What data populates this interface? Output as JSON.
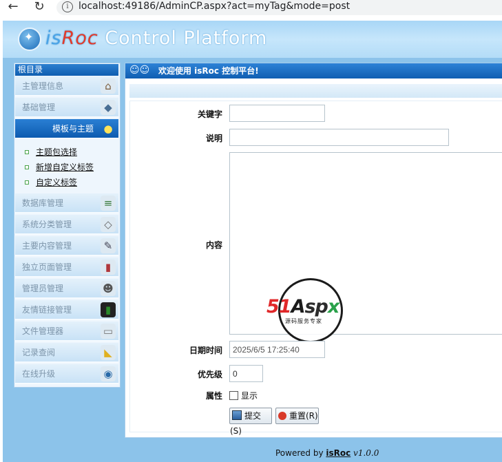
{
  "browser": {
    "url": "localhost:49186/AdminCP.aspx?act=myTag&mode=post",
    "back_glyph": "←",
    "reload_glyph": "↻",
    "info_glyph": "i"
  },
  "banner": {
    "logo_is": "is",
    "logo_roc": "Roc",
    "logo_rest": " Control Platform",
    "logo_glyph": "✦"
  },
  "sidebar": {
    "header": "根目录",
    "items": [
      {
        "label": "主管理信息",
        "icon": "house-icon",
        "glyph": "⌂"
      },
      {
        "label": "基础管理",
        "icon": "cube-icon",
        "glyph": "◆"
      },
      {
        "label": "模板与主题",
        "icon": "lightbulb-icon",
        "glyph": "●",
        "active": true
      },
      {
        "label": "数据库管理",
        "icon": "database-icon",
        "glyph": "≡"
      },
      {
        "label": "系统分类管理",
        "icon": "tag-icon",
        "glyph": "◇"
      },
      {
        "label": "主要内容管理",
        "icon": "book-open-icon",
        "glyph": "✎"
      },
      {
        "label": "独立页面管理",
        "icon": "books-icon",
        "glyph": "▮"
      },
      {
        "label": "管理员管理",
        "icon": "users-icon",
        "glyph": "☻"
      },
      {
        "label": "友情链接管理",
        "icon": "battery-icon",
        "glyph": "▮"
      },
      {
        "label": "文件管理器",
        "icon": "document-icon",
        "glyph": "▭"
      },
      {
        "label": "记录查阅",
        "icon": "pencil-icon",
        "glyph": "◣"
      },
      {
        "label": "在线升级",
        "icon": "globe-download-icon",
        "glyph": "◉"
      }
    ],
    "subitems": [
      "主题包选择",
      "新增自定义标签",
      "自定义标签"
    ]
  },
  "content": {
    "header": "欢迎使用 isRoc 控制平台!",
    "users_glyph": "☺☺"
  },
  "form": {
    "keyword_label": "关键字",
    "keyword_value": "",
    "desc_label": "说明",
    "desc_value": "",
    "content_label": "内容",
    "content_value": "",
    "date_label": "日期时间",
    "date_value": "2025/6/5 17:25:40",
    "priority_label": "优先级",
    "priority_value": "0",
    "attr_label": "属性",
    "show_label": "显示",
    "show_checked": false,
    "submit_label": "提交(S)",
    "reset_label": "重置(R)"
  },
  "watermark": {
    "num": "51",
    "a": "A",
    "sp": "sp",
    "x": "x",
    "sub": "源码服务专家"
  },
  "footer": {
    "powered": "Powered by ",
    "brand": "isRoc",
    "version": " v1.0.0"
  },
  "colors": {
    "accent_blue": "#0f5eb0",
    "page_bg": "#8cc3ea",
    "brand_red": "#e33a2a"
  }
}
